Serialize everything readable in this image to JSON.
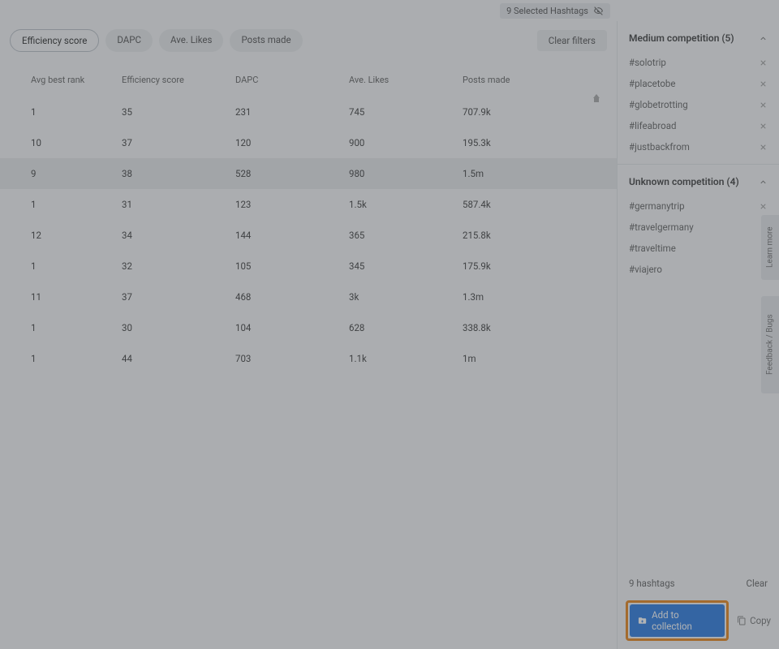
{
  "topbar": {
    "selected_label": "9 Selected Hashtags"
  },
  "filters": {
    "items": [
      {
        "label": "Efficiency score",
        "active": true
      },
      {
        "label": "DAPC",
        "active": false
      },
      {
        "label": "Ave. Likes",
        "active": false
      },
      {
        "label": "Posts made",
        "active": false
      }
    ],
    "clear_label": "Clear filters"
  },
  "table": {
    "headers": {
      "rank": "Avg best rank",
      "eff": "Efficiency score",
      "dapc": "DAPC",
      "likes": "Ave. Likes",
      "posts": "Posts made"
    },
    "rows": [
      {
        "rank": "1",
        "eff": "35",
        "dapc": "231",
        "likes": "745",
        "posts": "707.9k",
        "hl": false
      },
      {
        "rank": "10",
        "eff": "37",
        "dapc": "120",
        "likes": "900",
        "posts": "195.3k",
        "hl": false
      },
      {
        "rank": "9",
        "eff": "38",
        "dapc": "528",
        "likes": "980",
        "posts": "1.5m",
        "hl": true
      },
      {
        "rank": "1",
        "eff": "31",
        "dapc": "123",
        "likes": "1.5k",
        "posts": "587.4k",
        "hl": false
      },
      {
        "rank": "12",
        "eff": "34",
        "dapc": "144",
        "likes": "365",
        "posts": "215.8k",
        "hl": false
      },
      {
        "rank": "1",
        "eff": "32",
        "dapc": "105",
        "likes": "345",
        "posts": "175.9k",
        "hl": false
      },
      {
        "rank": "11",
        "eff": "37",
        "dapc": "468",
        "likes": "3k",
        "posts": "1.3m",
        "hl": false
      },
      {
        "rank": "1",
        "eff": "30",
        "dapc": "104",
        "likes": "628",
        "posts": "338.8k",
        "hl": false
      },
      {
        "rank": "1",
        "eff": "44",
        "dapc": "703",
        "likes": "1.1k",
        "posts": "1m",
        "hl": false
      }
    ]
  },
  "sidebar": {
    "groups": [
      {
        "title": "Medium competition (5)",
        "items": [
          {
            "label": "#solotrip",
            "removable": true
          },
          {
            "label": "#placetobe",
            "removable": true
          },
          {
            "label": "#globetrotting",
            "removable": true
          },
          {
            "label": "#lifeabroad",
            "removable": true
          },
          {
            "label": "#justbackfrom",
            "removable": true
          }
        ]
      },
      {
        "title": "Unknown competition (4)",
        "items": [
          {
            "label": "#germanytrip",
            "removable": true
          },
          {
            "label": "#travelgermany",
            "removable": false
          },
          {
            "label": "#traveltime",
            "removable": false
          },
          {
            "label": "#viajero",
            "removable": false
          }
        ]
      }
    ],
    "footer": {
      "count_label": "9 hashtags",
      "clear_label": "Clear"
    },
    "actions": {
      "add_label": "Add to collection",
      "copy_label": "Copy"
    }
  },
  "sidetabs": {
    "learn": "Learn more",
    "feedback": "Feedback / Bugs"
  }
}
